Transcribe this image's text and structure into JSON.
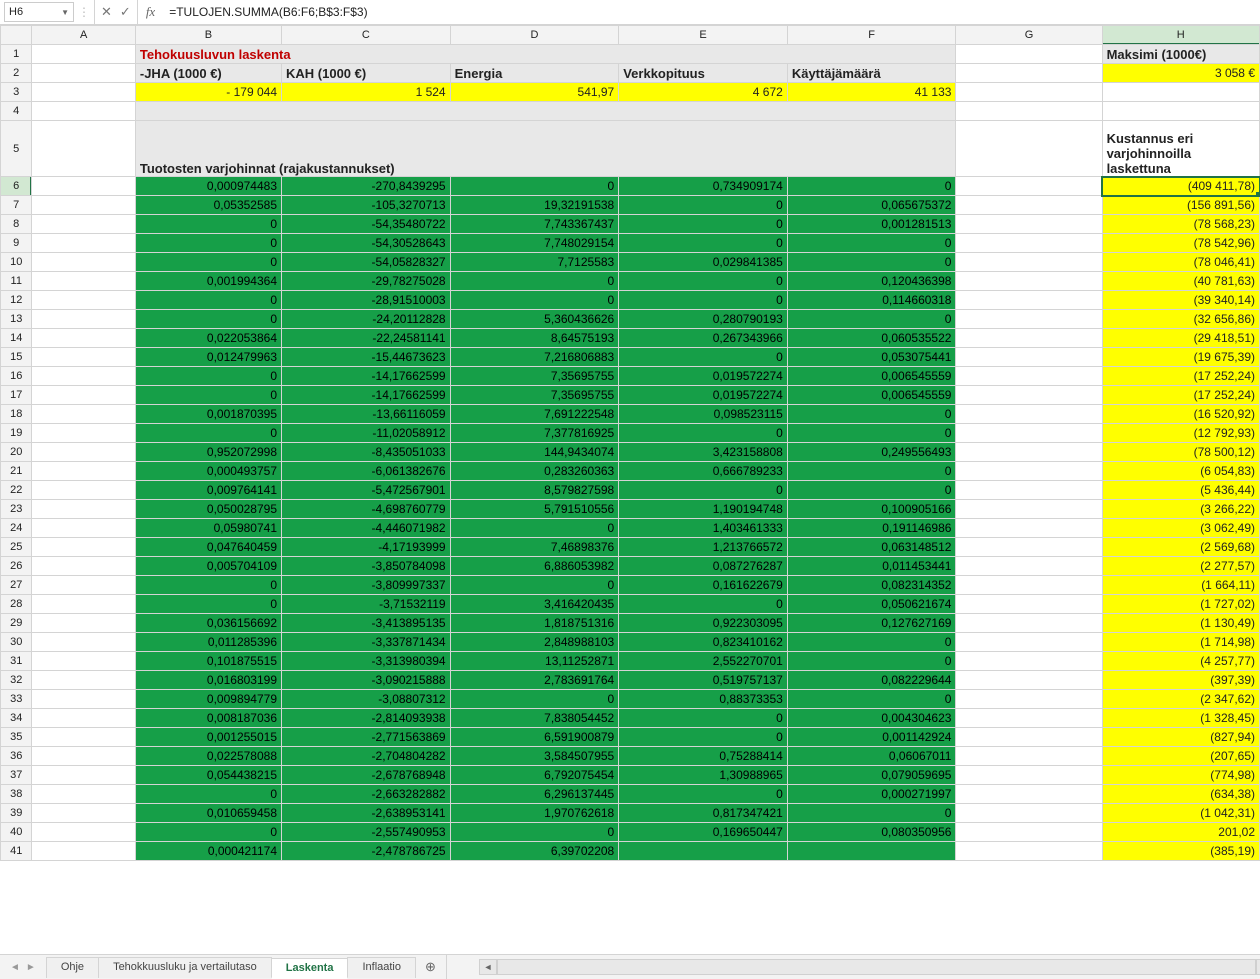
{
  "formula_bar": {
    "name_box": "H6",
    "formula": "=TULOJEN.SUMMA(B6:F6;B$3:F$3)"
  },
  "columns": [
    "",
    "A",
    "B",
    "C",
    "D",
    "E",
    "F",
    "G",
    "H"
  ],
  "rows": {
    "r1": {
      "B": "Tehokuusluvun laskenta",
      "H": "Maksimi (1000€)"
    },
    "r2": {
      "B": "-JHA (1000 €)",
      "C": "KAH (1000 €)",
      "D": "Energia",
      "E": "Verkkopituus",
      "F": "Käyttäjämäärä",
      "H": "3 058 €"
    },
    "r3": {
      "B": "-          179 044",
      "C": "1 524",
      "D": "541,97",
      "E": "4 672",
      "F": "41 133"
    },
    "r5": {
      "B": "Tuotosten varjohinnat (rajakustannukset)",
      "H": " Kustannus eri varjohinnoilla laskettuna"
    }
  },
  "data": [
    {
      "n": 6,
      "B": "0,000974483",
      "C": "-270,8439295",
      "D": "0",
      "E": "0,734909174",
      "F": "0",
      "H": "(409 411,78)"
    },
    {
      "n": 7,
      "B": "0,05352585",
      "C": "-105,3270713",
      "D": "19,32191538",
      "E": "0",
      "F": "0,065675372",
      "H": "(156 891,56)"
    },
    {
      "n": 8,
      "B": "0",
      "C": "-54,35480722",
      "D": "7,743367437",
      "E": "0",
      "F": "0,001281513",
      "H": "(78 568,23)"
    },
    {
      "n": 9,
      "B": "0",
      "C": "-54,30528643",
      "D": "7,748029154",
      "E": "0",
      "F": "0",
      "H": "(78 542,96)"
    },
    {
      "n": 10,
      "B": "0",
      "C": "-54,05828327",
      "D": "7,7125583",
      "E": "0,029841385",
      "F": "0",
      "H": "(78 046,41)"
    },
    {
      "n": 11,
      "B": "0,001994364",
      "C": "-29,78275028",
      "D": "0",
      "E": "0",
      "F": "0,120436398",
      "H": "(40 781,63)"
    },
    {
      "n": 12,
      "B": "0",
      "C": "-28,91510003",
      "D": "0",
      "E": "0",
      "F": "0,114660318",
      "H": "(39 340,14)"
    },
    {
      "n": 13,
      "B": "0",
      "C": "-24,20112828",
      "D": "5,360436626",
      "E": "0,280790193",
      "F": "0",
      "H": "(32 656,86)"
    },
    {
      "n": 14,
      "B": "0,022053864",
      "C": "-22,24581141",
      "D": "8,64575193",
      "E": "0,267343966",
      "F": "0,060535522",
      "H": "(29 418,51)"
    },
    {
      "n": 15,
      "B": "0,012479963",
      "C": "-15,44673623",
      "D": "7,216806883",
      "E": "0",
      "F": "0,053075441",
      "H": "(19 675,39)"
    },
    {
      "n": 16,
      "B": "0",
      "C": "-14,17662599",
      "D": "7,35695755",
      "E": "0,019572274",
      "F": "0,006545559",
      "H": "(17 252,24)"
    },
    {
      "n": 17,
      "B": "0",
      "C": "-14,17662599",
      "D": "7,35695755",
      "E": "0,019572274",
      "F": "0,006545559",
      "H": "(17 252,24)"
    },
    {
      "n": 18,
      "B": "0,001870395",
      "C": "-13,66116059",
      "D": "7,691222548",
      "E": "0,098523115",
      "F": "0",
      "H": "(16 520,92)"
    },
    {
      "n": 19,
      "B": "0",
      "C": "-11,02058912",
      "D": "7,377816925",
      "E": "0",
      "F": "0",
      "H": "(12 792,93)"
    },
    {
      "n": 20,
      "B": "0,952072998",
      "C": "-8,435051033",
      "D": "144,9434074",
      "E": "3,423158808",
      "F": "0,249556493",
      "H": "(78 500,12)"
    },
    {
      "n": 21,
      "B": "0,000493757",
      "C": "-6,061382676",
      "D": "0,283260363",
      "E": "0,666789233",
      "F": "0",
      "H": "(6 054,83)"
    },
    {
      "n": 22,
      "B": "0,009764141",
      "C": "-5,472567901",
      "D": "8,579827598",
      "E": "0",
      "F": "0",
      "H": "(5 436,44)"
    },
    {
      "n": 23,
      "B": "0,050028795",
      "C": "-4,698760779",
      "D": "5,791510556",
      "E": "1,190194748",
      "F": "0,100905166",
      "H": "(3 266,22)"
    },
    {
      "n": 24,
      "B": "0,05980741",
      "C": "-4,446071982",
      "D": "0",
      "E": "1,403461333",
      "F": "0,191146986",
      "H": "(3 062,49)"
    },
    {
      "n": 25,
      "B": "0,047640459",
      "C": "-4,17193999",
      "D": "7,46898376",
      "E": "1,213766572",
      "F": "0,063148512",
      "H": "(2 569,68)"
    },
    {
      "n": 26,
      "B": "0,005704109",
      "C": "-3,850784098",
      "D": "6,886053982",
      "E": "0,087276287",
      "F": "0,011453441",
      "H": "(2 277,57)"
    },
    {
      "n": 27,
      "B": "0",
      "C": "-3,809997337",
      "D": "0",
      "E": "0,161622679",
      "F": "0,082314352",
      "H": "(1 664,11)"
    },
    {
      "n": 28,
      "B": "0",
      "C": "-3,71532119",
      "D": "3,416420435",
      "E": "0",
      "F": "0,050621674",
      "H": "(1 727,02)"
    },
    {
      "n": 29,
      "B": "0,036156692",
      "C": "-3,413895135",
      "D": "1,818751316",
      "E": "0,922303095",
      "F": "0,127627169",
      "H": "(1 130,49)"
    },
    {
      "n": 30,
      "B": "0,011285396",
      "C": "-3,337871434",
      "D": "2,848988103",
      "E": "0,823410162",
      "F": "0",
      "H": "(1 714,98)"
    },
    {
      "n": 31,
      "B": "0,101875515",
      "C": "-3,313980394",
      "D": "13,11252871",
      "E": "2,552270701",
      "F": "0",
      "H": "(4 257,77)"
    },
    {
      "n": 32,
      "B": "0,016803199",
      "C": "-3,090215888",
      "D": "2,783691764",
      "E": "0,519757137",
      "F": "0,082229644",
      "H": "(397,39)"
    },
    {
      "n": 33,
      "B": "0,009894779",
      "C": "-3,08807312",
      "D": "0",
      "E": "0,88373353",
      "F": "0",
      "H": "(2 347,62)"
    },
    {
      "n": 34,
      "B": "0,008187036",
      "C": "-2,814093938",
      "D": "7,838054452",
      "E": "0",
      "F": "0,004304623",
      "H": "(1 328,45)"
    },
    {
      "n": 35,
      "B": "0,001255015",
      "C": "-2,771563869",
      "D": "6,591900879",
      "E": "0",
      "F": "0,001142924",
      "H": "(827,94)"
    },
    {
      "n": 36,
      "B": "0,022578088",
      "C": "-2,704804282",
      "D": "3,584507955",
      "E": "0,75288414",
      "F": "0,06067011",
      "H": "(207,65)"
    },
    {
      "n": 37,
      "B": "0,054438215",
      "C": "-2,678768948",
      "D": "6,792075454",
      "E": "1,30988965",
      "F": "0,079059695",
      "H": "(774,98)"
    },
    {
      "n": 38,
      "B": "0",
      "C": "-2,663282882",
      "D": "6,296137445",
      "E": "0",
      "F": "0,000271997",
      "H": "(634,38)"
    },
    {
      "n": 39,
      "B": "0,010659458",
      "C": "-2,638953141",
      "D": "1,970762618",
      "E": "0,817347421",
      "F": "0",
      "H": "(1 042,31)"
    },
    {
      "n": 40,
      "B": "0",
      "C": "-2,557490953",
      "D": "0",
      "E": "0,169650447",
      "F": "0,080350956",
      "H": "201,02"
    },
    {
      "n": 41,
      "B": "0,000421174",
      "C": "-2,478786725",
      "D": "6,39702208",
      "E": "",
      "F": "",
      "H": "(385,19)"
    }
  ],
  "tabs": [
    {
      "label": "Ohje",
      "active": false
    },
    {
      "label": "Tehokkuusluku ja vertailutaso",
      "active": false
    },
    {
      "label": "Laskenta",
      "active": true
    },
    {
      "label": "Inflaatio",
      "active": false
    }
  ]
}
